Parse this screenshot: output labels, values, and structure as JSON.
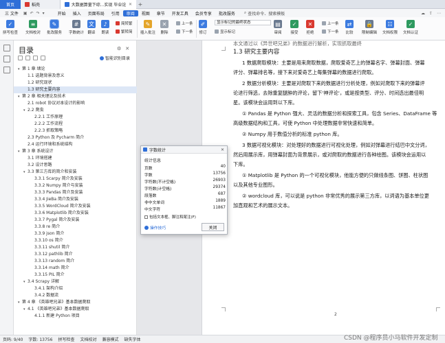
{
  "tabs": {
    "home": "首页",
    "doc1": "稻壳",
    "doc2": "大数据算量下综...实现 毕业论文",
    "add": "+"
  },
  "menu": {
    "file": "三 文件",
    "items": [
      "开始",
      "插入",
      "页面布局",
      "引用",
      "审阅",
      "视图",
      "章节",
      "开发工具",
      "会员专享",
      "批改服务"
    ],
    "active": "审阅",
    "search": "查找命令、搜索模板"
  },
  "ribbon": {
    "spellcheck": "拼写检查",
    "doc_check": "文档校对",
    "review_service": "批改服务",
    "word_count": "字数统计",
    "translate": "翻译",
    "read_aloud": "朗读",
    "simp_trad": "简转繁",
    "trad_simp": "繁转简",
    "insert_comment": "插入批注",
    "delete": "删除",
    "prev_comment": "上一条",
    "next_comment": "下一条",
    "track": "修订",
    "dropdown": "显示标记的最终状态",
    "show_markup": "显示标记",
    "review": "审阅",
    "accept": "接受",
    "reject": "拒绝",
    "prev_change": "上一条",
    "next_change": "下一条",
    "compare": "比较",
    "restrict": "限制编辑",
    "doc_rights": "文档权限",
    "doc_verify": "文档认证"
  },
  "nav": {
    "title": "目录",
    "smart": "智能识别目录",
    "toc": [
      {
        "t": "第 1 章  绪论",
        "lvl": 1,
        "tw": "▾"
      },
      {
        "t": "1.1  选题背景及意义",
        "lvl": 2,
        "tw": ""
      },
      {
        "t": "1.2  研究现状",
        "lvl": 2,
        "tw": ""
      },
      {
        "t": "1.3  研究主要内容",
        "lvl": 2,
        "tw": "",
        "sel": true
      },
      {
        "t": "第 2 章  相关理论及技术",
        "lvl": 1,
        "tw": "▾"
      },
      {
        "t": "2.1 robot 协议对本设计的影响",
        "lvl": 2,
        "tw": ""
      },
      {
        "t": "2.2  爬虫",
        "lvl": 2,
        "tw": "▾"
      },
      {
        "t": "2.2.1  工作原理",
        "lvl": 3,
        "tw": ""
      },
      {
        "t": "2.2.2  工作流程",
        "lvl": 3,
        "tw": ""
      },
      {
        "t": "2.2.3  抓取策略",
        "lvl": 3,
        "tw": ""
      },
      {
        "t": "2.3 Python 及 Pycharm 简介",
        "lvl": 2,
        "tw": ""
      },
      {
        "t": "2.4 运行环境和系统结构",
        "lvl": 2,
        "tw": ""
      },
      {
        "t": "第 3 章  系统设计",
        "lvl": 1,
        "tw": "▾"
      },
      {
        "t": "3.1  环境搭建",
        "lvl": 2,
        "tw": ""
      },
      {
        "t": "3.2  设计思路",
        "lvl": 2,
        "tw": ""
      },
      {
        "t": "3.3  第三方库的简介和安装",
        "lvl": 2,
        "tw": "▾"
      },
      {
        "t": "3.3.1 Scarpy 简介及安装",
        "lvl": 3,
        "tw": ""
      },
      {
        "t": "3.3.2 Numpy 简介与安装",
        "lvl": 3,
        "tw": ""
      },
      {
        "t": "3.3.3 Pandas 简介及安装",
        "lvl": 3,
        "tw": ""
      },
      {
        "t": "3.3.4 JieBa 简介及安装",
        "lvl": 3,
        "tw": ""
      },
      {
        "t": "3.3.5 WordCloud 简介及安装",
        "lvl": 3,
        "tw": ""
      },
      {
        "t": "3.3.6 Matplotlib 简介及安装",
        "lvl": 3,
        "tw": ""
      },
      {
        "t": "3.3.7 Pygal 简介及安装",
        "lvl": 3,
        "tw": ""
      },
      {
        "t": "3.3.8 re 简介",
        "lvl": 3,
        "tw": ""
      },
      {
        "t": "3.3.9 json 简介",
        "lvl": 3,
        "tw": ""
      },
      {
        "t": "3.3.10 os 简介",
        "lvl": 3,
        "tw": ""
      },
      {
        "t": "3.3.11 shutil 简介",
        "lvl": 3,
        "tw": ""
      },
      {
        "t": "3.3.12 pathlib 简介",
        "lvl": 3,
        "tw": ""
      },
      {
        "t": "3.3.13 random 简介",
        "lvl": 3,
        "tw": ""
      },
      {
        "t": "3.3.14 math 简介",
        "lvl": 3,
        "tw": ""
      },
      {
        "t": "3.3.15 PIL 简介",
        "lvl": 3,
        "tw": ""
      },
      {
        "t": "3.4 Scrapy 详解",
        "lvl": 2,
        "tw": "▾"
      },
      {
        "t": "3.4.1  架构介绍",
        "lvl": 3,
        "tw": ""
      },
      {
        "t": "3.4.2  数据流",
        "lvl": 3,
        "tw": ""
      },
      {
        "t": "第 4 章 《英雄吧兄弟》基本数据爬取",
        "lvl": 1,
        "tw": "▾"
      },
      {
        "t": "4.1 《英雄吧兄弟》基本数据爬取",
        "lvl": 2,
        "tw": "▾"
      },
      {
        "t": "4.1.1  新建 Python 项目",
        "lvl": 3,
        "tw": ""
      }
    ]
  },
  "doc": {
    "line0": "本文通过以《异世吧兄弟》的数据进行解析，实现抓取最终",
    "heading": "1.3  研究主要内容",
    "p1a": "1 数据爬取模块：主要是用来爬取数据，爬取爱奇艺上的弹幕名字、弹幕封面、弹幕",
    "p1b": "评分、弹幕排名等，接下来对爱奇艺上每集弹幕的数据进行爬取。",
    "p2a": "2 数据分析模块：主要是对爬取下来的数据进行分析处理，例如对爬取下来的弹幕评",
    "p2b": "论进行筛选，去除重复腿肿的评论，留下'神评论'，或是按类型、评分、时间选出最佳明",
    "p2c": "星。该模块会运用到以下库。",
    "p3": "①   Pandas 是 Python 强大、灵活的数据分析和探索工具，包含 Series、DataFrame 等",
    "p3b": "高级数据结构和工具，可使 Python 中处理数据非常快速和简单。",
    "p4": "②   Numpy 用于数值分析的标准 python 库。",
    "p5a": "3 数据可视化模块：对处理好的数据进行可视化处理，例如对弹幕进行结巴中文分词，",
    "p5b": "然后用展示库，用弹幕封面为背景展示，或对爬取的数据进行各种绘图。该模块会运用以",
    "p5c": "下库。",
    "p6a": "①   Matplotlib 是 Python 的一个可视化模块，他能方便的只做线条图、饼图、柱状图",
    "p6b": "以及其他专业图形。",
    "p7a": "②   wordcloud 库，可以说是 python 非常优秀的展示第三方库，以词语为基本单位更",
    "p7b": "加直观和艺术的展示文本。",
    "page_number": "2"
  },
  "dialog": {
    "title": "字数统计",
    "section": "统计信息",
    "rows": [
      {
        "label": "页数",
        "value": "40"
      },
      {
        "label": "字数",
        "value": "13756"
      },
      {
        "label": "字符数(不计空格)",
        "value": "26903"
      },
      {
        "label": "字符数(计空格)",
        "value": "29374"
      },
      {
        "label": "段落数",
        "value": "687"
      },
      {
        "label": "非中文单词",
        "value": "1889"
      },
      {
        "label": "中文字符",
        "value": "11867"
      }
    ],
    "checkbox": "包括文本框、脚注和尾注(F)",
    "tips": "操作技巧",
    "close": "关闭"
  },
  "status": {
    "page": "页码: 9/40",
    "words": "字数: 13756",
    "spell": "拼写检查",
    "proof": "文档校对",
    "compat": "兼容模式",
    "missing_font": "缺失字体"
  },
  "watermark": "CSDN @程序员小马软件开发定制"
}
